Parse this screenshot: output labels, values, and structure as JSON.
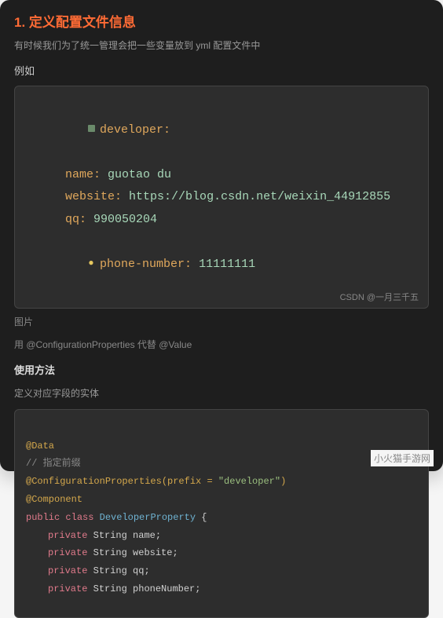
{
  "heading": "1. 定义配置文件信息",
  "description": "有时候我们为了统一管理会把一些变量放到 yml 配置文件中",
  "example_label": "例如",
  "yml": {
    "root_key": "developer",
    "entries": [
      {
        "key": "name",
        "value": "guotao du"
      },
      {
        "key": "website",
        "value": "https://blog.csdn.net/weixin_44912855"
      },
      {
        "key": "qq",
        "value": "990050204"
      },
      {
        "key": "phone-number",
        "value": "11111111"
      }
    ]
  },
  "csdn_watermark": "CSDN @一月三千五",
  "image_caption": "图片",
  "config_note": "用 @ConfigurationProperties 代替 @Value",
  "usage_title": "使用方法",
  "usage_subtext": "定义对应字段的实体",
  "java": {
    "anno_data": "@Data",
    "comment_prefix": "// 指定前缀",
    "anno_config_prefix": "@ConfigurationProperties",
    "anno_config_args_open": "(prefix = ",
    "anno_config_value": "\"developer\"",
    "anno_config_args_close": ")",
    "anno_component": "@Component",
    "kw_public": "public",
    "kw_class": "class",
    "class_name": "DeveloperProperty",
    "brace_open": " {",
    "kw_private": "private",
    "type_string": "String",
    "fields": [
      "name",
      "website",
      "qq",
      "phoneNumber"
    ],
    "semicolon": ";"
  },
  "site_watermark": "小火猫手游网"
}
